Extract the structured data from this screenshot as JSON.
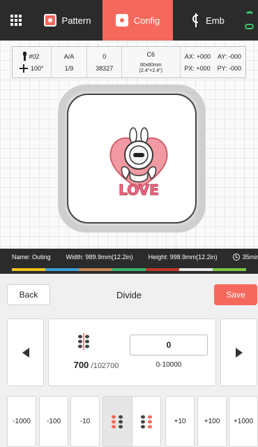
{
  "topbar": {
    "menu_icon": "grid-menu-icon",
    "tabs": [
      {
        "label": "Pattern",
        "icon": "pattern-icon",
        "active": false
      },
      {
        "label": "Config",
        "icon": "config-icon",
        "active": true
      },
      {
        "label": "Emb",
        "icon": "needle-icon",
        "active": false
      }
    ],
    "status_icons": [
      "wifi-icon",
      "cloud-icon"
    ],
    "accent_color": "#f4695c"
  },
  "info_panel": {
    "needle": "#02",
    "angle": "100°",
    "ratio_top": "A/A",
    "ratio_bottom": "1/9",
    "stitch_top": "0",
    "stitch_bottom": "38327",
    "hoop_name": "C6",
    "hoop_size_mm": "60x60mm",
    "hoop_size_in": "(2.4\"×2.4\")",
    "ax": "AX: +000",
    "ay": "AY: -000",
    "px": "PX: +000",
    "py": "PY: -000"
  },
  "design": {
    "text": "LOVE"
  },
  "info_strip": {
    "name": "Name: Outing",
    "width": "Width: 989.9mm(12.2in)",
    "height": "Height: 998.9mm(12.2in)",
    "time": "35min",
    "thread_colors": [
      "#f0c419",
      "#3aa0d8",
      "#c98a5a",
      "#3cb371",
      "#c0392b",
      "#e8e8e8",
      "#7ac943"
    ]
  },
  "divide": {
    "back_label": "Back",
    "title": "Divide",
    "save_label": "Save",
    "current_stitch": "700",
    "total_stitch": "/102700",
    "input_value": "0",
    "range": "0-10000",
    "steps_left": [
      "-1000",
      "-100",
      "-10"
    ],
    "steps_right": [
      "+10",
      "+100",
      "+1000"
    ]
  }
}
